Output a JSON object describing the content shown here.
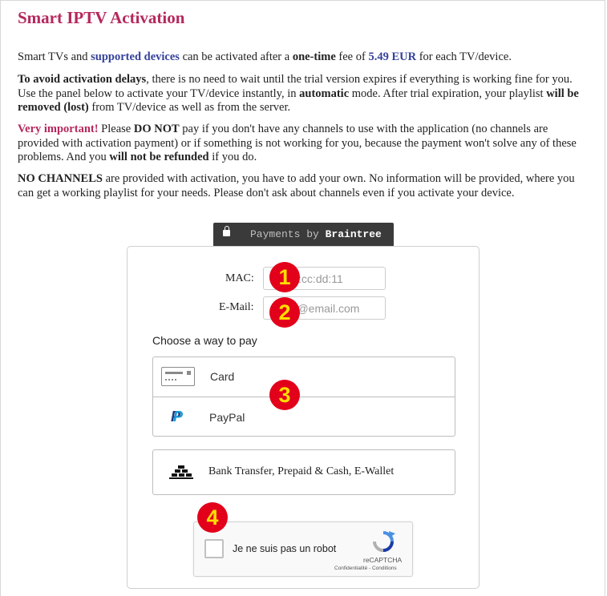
{
  "header": {
    "title": "Smart IPTV Activation"
  },
  "intro": {
    "p1": {
      "t1": "Smart TVs and ",
      "link": "supported devices",
      "t2": " can be activated after a ",
      "bold1": "one-time",
      "t3": " fee of ",
      "price": "5.49 EUR",
      "t4": " for each TV/device."
    },
    "p2": {
      "bold1": "To avoid activation delays",
      "t1": ", there is no need to wait until the trial version expires if everything is working fine for you. Use the panel below to activate your TV/device instantly, in ",
      "bold2": "automatic",
      "t2": " mode. After trial expiration, your playlist ",
      "bold3": "will be removed (lost)",
      "t3": " from TV/device as well as from the server."
    },
    "p3": {
      "warn": "Very important!",
      "t1": " Please ",
      "bold1": "DO NOT",
      "t2": " pay if you don't have any channels to use with the application (no channels are provided with activation payment) or if something is not working for you, because the payment won't solve any of these problems. And you ",
      "bold2": "will not be refunded",
      "t3": " if you do."
    },
    "p4": {
      "bold1": "NO CHANNELS",
      "t1": " are provided with activation, you have to add your own. No information will be provided, where you can get a working playlist for your needs. Please don't ask about channels even if you activate your device."
    }
  },
  "payments_tab": {
    "prefix": "Payments by ",
    "brand": "Braintree",
    "icon": "lock-icon"
  },
  "form": {
    "mac_label": "MAC:",
    "mac_placeholder": "aa:bb:cc:dd:11",
    "email_label": "E-Mail:",
    "email_placeholder": "email@email.com"
  },
  "pay": {
    "choose_label": "Choose a way to pay",
    "methods": [
      {
        "label": "Card",
        "icon": "credit-card-icon"
      },
      {
        "label": "PayPal",
        "icon": "paypal-icon"
      }
    ],
    "bank": {
      "label": "Bank Transfer, Prepaid & Cash, E-Wallet",
      "icon": "bank-icon"
    }
  },
  "captcha": {
    "label": "Je ne suis pas un robot",
    "brand": "reCAPTCHA",
    "terms": "Confidentialité - Conditions"
  },
  "badges": [
    "1",
    "2",
    "3",
    "4"
  ],
  "colors": {
    "title": "#b5285d",
    "link": "#35429a",
    "badge_bg": "#e2001a",
    "badge_fg": "#ffde00",
    "tab_bg": "#3a3a3a"
  }
}
